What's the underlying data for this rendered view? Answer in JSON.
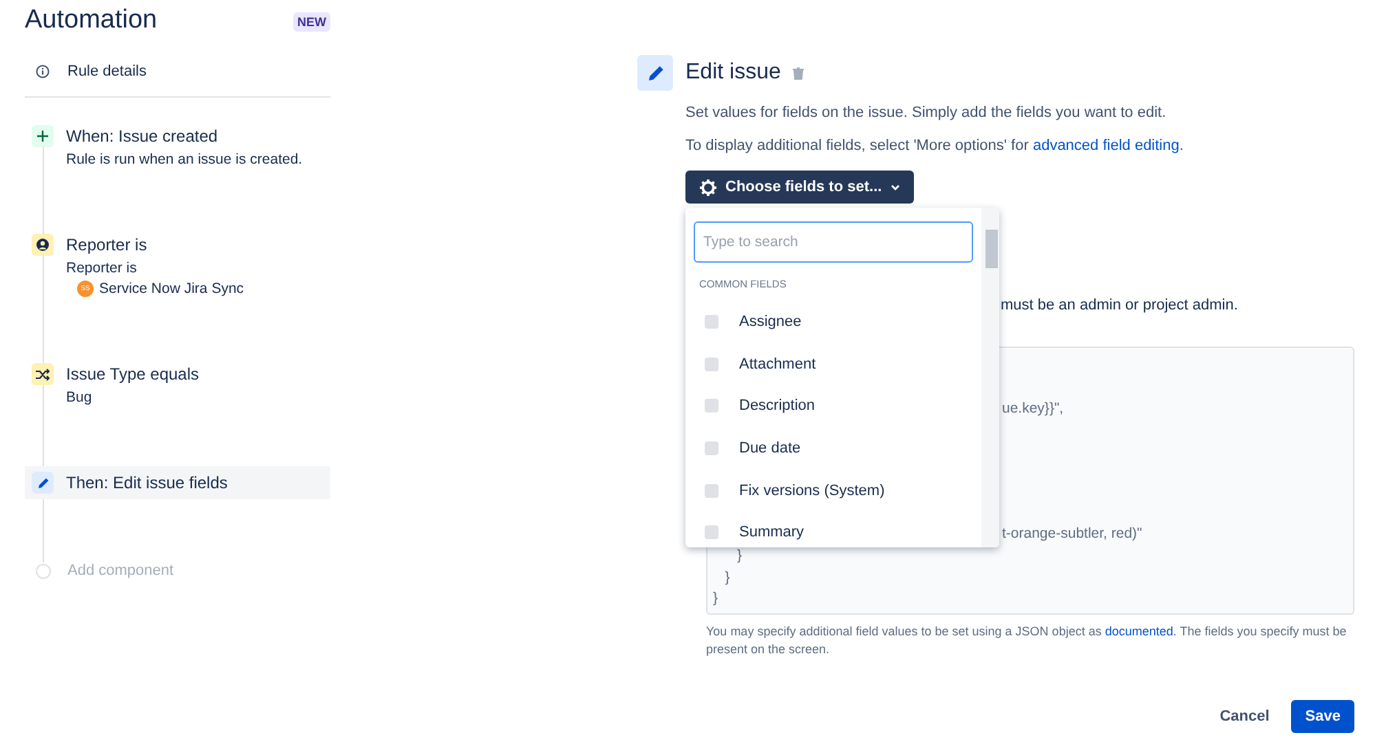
{
  "app": {
    "title": "Automation",
    "badge": "NEW"
  },
  "rule_details": {
    "label": "Rule details"
  },
  "steps": [
    {
      "kind": "trigger",
      "title": "When: Issue created",
      "lines": [
        "Rule is run when an issue is created."
      ],
      "selected": false
    },
    {
      "kind": "user-condition",
      "title": "Reporter is",
      "lines": [
        "Reporter is"
      ],
      "user": {
        "initials": "SS",
        "name": "Service Now Jira Sync"
      },
      "selected": false
    },
    {
      "kind": "type-condition",
      "title": "Issue Type equals",
      "lines": [
        "Bug"
      ],
      "selected": false
    },
    {
      "kind": "action",
      "title": "Then: Edit issue fields",
      "selected": true
    }
  ],
  "add_component": {
    "label": "Add component"
  },
  "editor": {
    "title": "Edit issue",
    "description": "Set values for fields on the issue. Simply add the fields you want to edit.",
    "more_text": "To display additional fields, select 'More options' for ",
    "more_link": "advanced field editing",
    "more_end": ".",
    "choose_button": "Choose fields to set...",
    "permission_note": "must be an admin or project admin.",
    "json_lines": [
      {
        "kind": "cut",
        "text": "ue.key}}\","
      },
      {
        "kind": "cut",
        "text": "t-orange-subtler, red)\""
      },
      {
        "kind": "code",
        "text": "      }"
      },
      {
        "kind": "code",
        "text": "   }"
      },
      {
        "kind": "code",
        "text": "}"
      }
    ],
    "help_text": "You may specify additional field values to be set using a JSON object as ",
    "help_link": "documented",
    "help_end": ". The fields you specify must be present on the screen."
  },
  "dropdown": {
    "placeholder": "Type to search",
    "section": "COMMON FIELDS",
    "options": [
      {
        "label": "Assignee",
        "checked": false
      },
      {
        "label": "Attachment",
        "checked": false
      },
      {
        "label": "Description",
        "checked": false
      },
      {
        "label": "Due date",
        "checked": false
      },
      {
        "label": "Fix versions (System)",
        "checked": false
      },
      {
        "label": "Summary",
        "checked": false
      }
    ]
  },
  "buttons": {
    "cancel": "Cancel",
    "save": "Save"
  }
}
